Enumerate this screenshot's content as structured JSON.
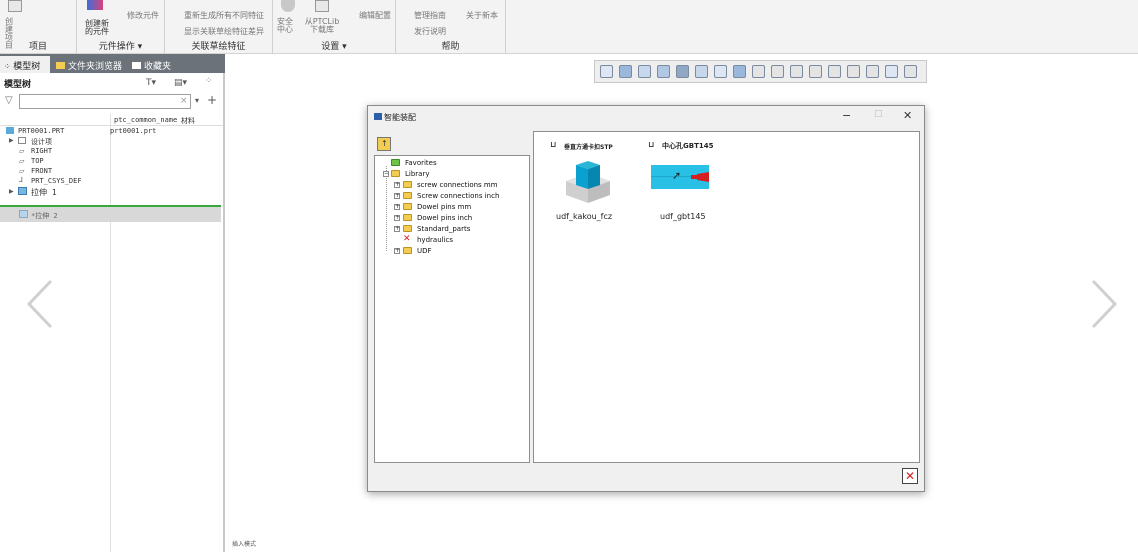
{
  "ribbon": {
    "groups": [
      {
        "label": "项目"
      },
      {
        "label": "元件操作 ▾"
      },
      {
        "label": "关联草绘特征"
      },
      {
        "label": "设置 ▾"
      },
      {
        "label": "帮助"
      }
    ],
    "project_btn_label": "创建\n项目",
    "create_part_label": "创建新的元件",
    "modify_part_label": "修改元件",
    "regen_label": "重新生成所有不同特征",
    "show_sketch_label": "显示关联草绘特征差异",
    "security_label": "安全中心",
    "from_ptc_label": "从PTCLib下载库",
    "edit_config_label": "编辑配置",
    "manage_lib_label": "管理指南",
    "about_label": "关于新本",
    "release_notes_label": "发行说明"
  },
  "left_panel": {
    "tabs": [
      "模型树",
      "文件夹浏览器",
      "收藏夹"
    ],
    "tree_title": "模型树",
    "filter_value": "",
    "columns": [
      "ptc_common_name",
      "材料"
    ],
    "rows": [
      {
        "name": "PRT0001.PRT",
        "common": "prt0001.prt"
      },
      {
        "name": "设计项"
      },
      {
        "name": "RIGHT"
      },
      {
        "name": "TOP"
      },
      {
        "name": "FRONT"
      },
      {
        "name": "PRT_CSYS_DEF"
      },
      {
        "name": "拉伸 1"
      }
    ],
    "insert_row": "*拉伸 2"
  },
  "dialog": {
    "title": "智能装配",
    "library_tree": [
      {
        "label": "Favorites",
        "level": 1
      },
      {
        "label": "Library",
        "level": 1
      },
      {
        "label": "screw connections mm",
        "level": 2
      },
      {
        "label": "Screw connections inch",
        "level": 2
      },
      {
        "label": "Dowel pins mm",
        "level": 2
      },
      {
        "label": "Dowel pins inch",
        "level": 2
      },
      {
        "label": "Standard_parts",
        "level": 2
      },
      {
        "label": "hydraulics",
        "level": 2
      },
      {
        "label": "UDF",
        "level": 2
      }
    ],
    "items": [
      {
        "header": "垂直方通卡扣STP",
        "caption": "udf_kakou_fcz"
      },
      {
        "header": "中心孔GBT145",
        "caption": "udf_gbt145"
      }
    ],
    "minimize": "−",
    "maximize": "□",
    "close": "✕"
  },
  "status_text": "插入模式",
  "colors": {
    "tab_bar": "#6b7279",
    "accent_blue": "#0aa0d0",
    "close_red": "#d42020"
  }
}
